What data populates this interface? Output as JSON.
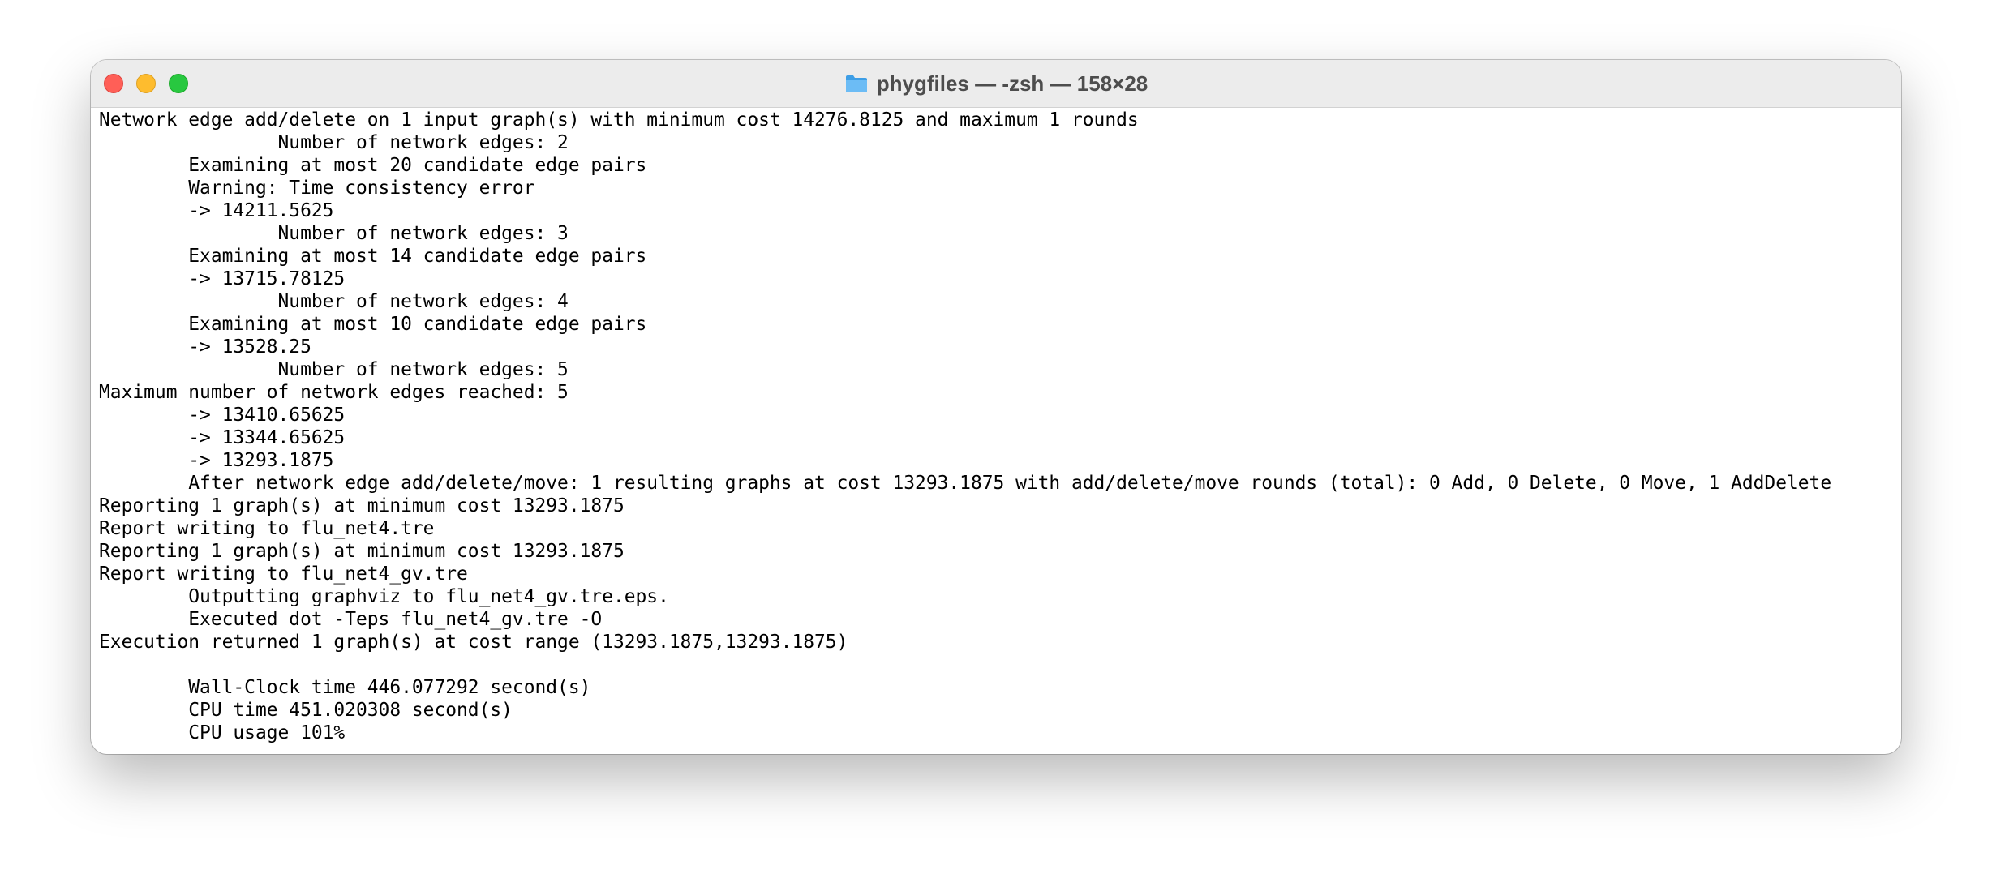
{
  "window": {
    "title": "phygfiles — -zsh — 158×28",
    "title_icon": "folder-icon",
    "traffic_lights": {
      "close_color": "#ff5f57",
      "minimize_color": "#febc2e",
      "zoom_color": "#28c840"
    }
  },
  "terminal": {
    "lines": [
      "Network edge add/delete on 1 input graph(s) with minimum cost 14276.8125 and maximum 1 rounds",
      "\t\tNumber of network edges: 2",
      "\tExamining at most 20 candidate edge pairs",
      "\tWarning: Time consistency error",
      "\t-> 14211.5625",
      "\t\tNumber of network edges: 3",
      "\tExamining at most 14 candidate edge pairs",
      "\t-> 13715.78125",
      "\t\tNumber of network edges: 4",
      "\tExamining at most 10 candidate edge pairs",
      "\t-> 13528.25",
      "\t\tNumber of network edges: 5",
      "Maximum number of network edges reached: 5",
      "\t-> 13410.65625",
      "\t-> 13344.65625",
      "\t-> 13293.1875",
      "\tAfter network edge add/delete/move: 1 resulting graphs at cost 13293.1875 with add/delete/move rounds (total): 0 Add, 0 Delete, 0 Move, 1 AddDelete",
      "Reporting 1 graph(s) at minimum cost 13293.1875",
      "Report writing to flu_net4.tre",
      "Reporting 1 graph(s) at minimum cost 13293.1875",
      "Report writing to flu_net4_gv.tre",
      "\tOutputting graphviz to flu_net4_gv.tre.eps.",
      "\tExecuted dot -Teps flu_net4_gv.tre -O",
      "Execution returned 1 graph(s) at cost range (13293.1875,13293.1875)",
      "",
      "\tWall-Clock time 446.077292 second(s)",
      "\tCPU time 451.020308 second(s)",
      "\tCPU usage 101%"
    ]
  }
}
